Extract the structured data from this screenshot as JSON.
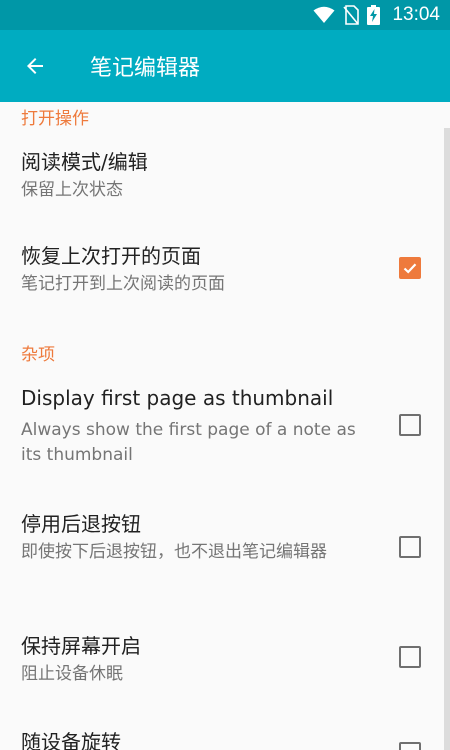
{
  "status_bar": {
    "time": "13:04",
    "icons": [
      "wifi-icon",
      "no-sim-icon",
      "battery-charging-icon"
    ]
  },
  "app_bar": {
    "back_icon": "arrow-left-icon",
    "title": "笔记编辑器"
  },
  "sections": {
    "open": {
      "header": "打开操作",
      "read_mode": {
        "title": "阅读模式/编辑",
        "summary": "保留上次状态"
      },
      "restore_page": {
        "title": "恢复上次打开的页面",
        "summary": "笔记打开到上次阅读的页面",
        "checked": true
      }
    },
    "misc": {
      "header": "杂项",
      "thumbnail": {
        "title": "Display first page as thumbnail",
        "summary": "Always show the first page of a note as its thumbnail",
        "checked": false
      },
      "disable_back": {
        "title": "停用后退按钮",
        "summary": "即使按下后退按钮，也不退出笔记编辑器",
        "checked": false
      },
      "keep_screen_on": {
        "title": "保持屏幕开启",
        "summary": "阻止设备休眠",
        "checked": false
      },
      "rotate": {
        "title": "随设备旋转",
        "checked": false
      }
    }
  },
  "colors": {
    "status_bar": "#0097a7",
    "app_bar": "#00acc1",
    "accent": "#ee7a3c"
  }
}
